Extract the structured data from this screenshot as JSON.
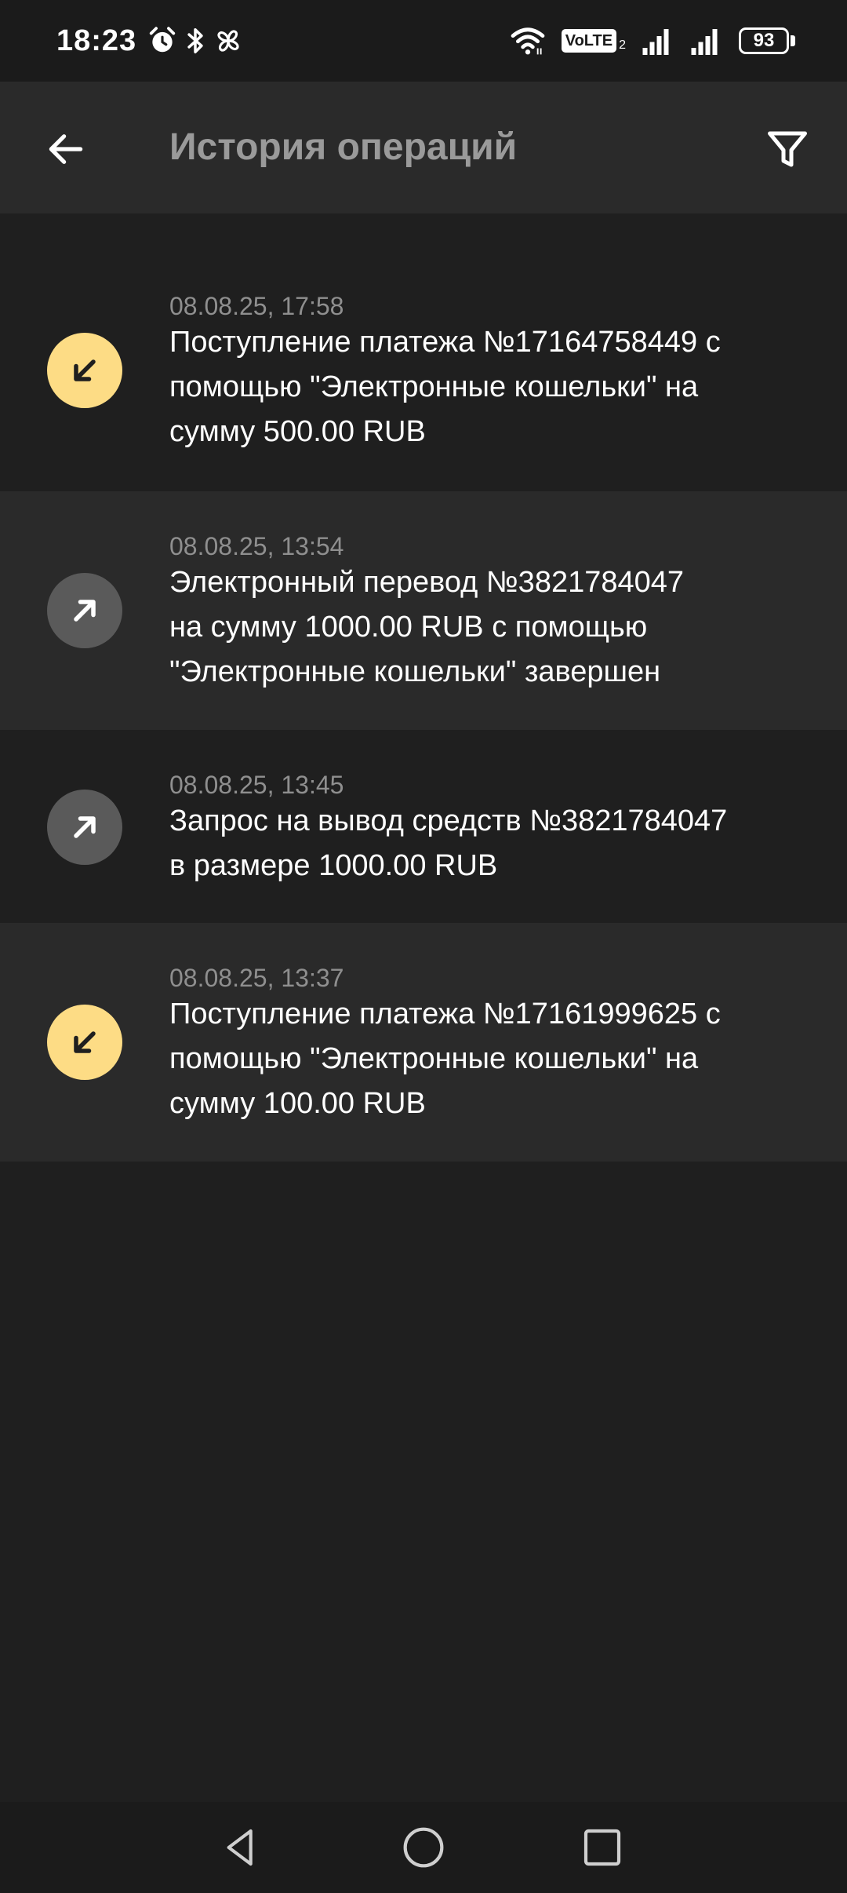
{
  "status_bar": {
    "time": "18:23",
    "volte_label": "VoLTE",
    "volte_sub": "2",
    "battery": "93",
    "icons": [
      "alarm-icon",
      "bluetooth-icon",
      "pinwheel-icon",
      "wifi-icon",
      "signal-icon",
      "signal-icon",
      "battery-icon"
    ]
  },
  "header": {
    "title": "История операций",
    "back_icon": "arrow-left-icon",
    "filter_icon": "filter-icon"
  },
  "operations": [
    {
      "direction": "incoming",
      "date": "08.08.25, 17:58",
      "description": "Поступление платежа №17164758449 с\nпомощью \"Электронные кошельки\" на\nсумму 500.00 RUB"
    },
    {
      "direction": "outgoing",
      "date": "08.08.25, 13:54",
      "description": "Электронный перевод №3821784047\nна сумму 1000.00 RUB с помощью\n\"Электронные кошельки\" завершен"
    },
    {
      "direction": "outgoing",
      "date": "08.08.25, 13:45",
      "description": "Запрос на вывод средств №3821784047\nв размере 1000.00 RUB"
    },
    {
      "direction": "incoming",
      "date": "08.08.25, 13:37",
      "description": "Поступление платежа №17161999625 с\nпомощью \"Электронные кошельки\" на\nсумму 100.00 RUB"
    }
  ],
  "colors": {
    "background": "#1f1f1f",
    "row_alt": "#2a2a2a",
    "incoming_icon_bg": "#fddc85",
    "outgoing_icon_bg": "#5a5a5a",
    "title_text": "#9a9a9a",
    "date_text": "#8f8f8f"
  },
  "nav_bar": {
    "icons": [
      "nav-back-icon",
      "nav-home-icon",
      "nav-recents-icon"
    ]
  }
}
